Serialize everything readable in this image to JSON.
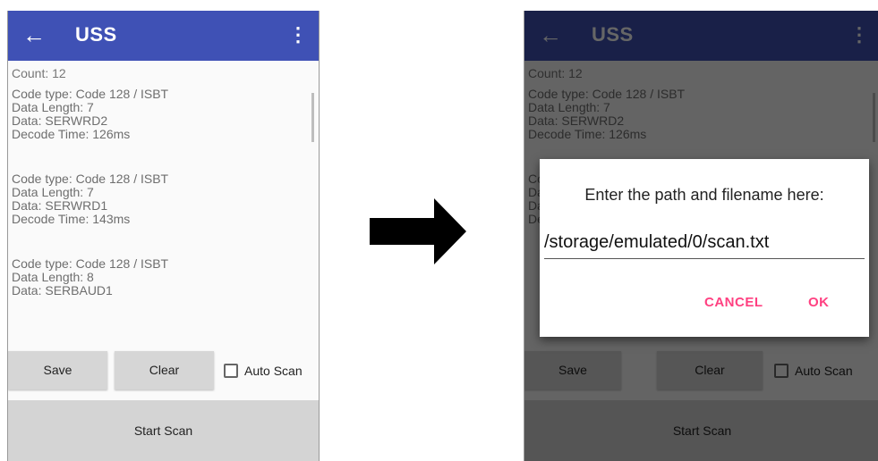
{
  "app": {
    "title": "USS"
  },
  "count_label": "Count:  12",
  "entries": [
    [
      "Code type: Code 128 / ISBT",
      "Data Length: 7",
      "Data: SERWRD2",
      "Decode Time: 126ms"
    ],
    [
      "Code type: Code 128 / ISBT",
      "Data Length: 7",
      "Data: SERWRD1",
      "Decode Time: 143ms"
    ],
    [
      "Code type: Code 128 / ISBT",
      "Data Length: 8",
      "Data: SERBAUD1"
    ]
  ],
  "buttons": {
    "save": "Save",
    "clear": "Clear",
    "start_scan": "Start Scan"
  },
  "auto_scan": {
    "label": "Auto Scan",
    "checked": false
  },
  "dialog": {
    "message": "Enter the path and filename here:",
    "path_value": "/storage/emulated/0/scan.txt",
    "cancel": "CANCEL",
    "ok": "OK"
  },
  "icons": [
    "back-arrow-icon",
    "overflow-menu-icon",
    "transition-arrow-icon"
  ],
  "colors": {
    "appbar": "#3f51b5",
    "accent": "#ff4081",
    "overlay": "rgba(0,0,0,0.6)"
  }
}
